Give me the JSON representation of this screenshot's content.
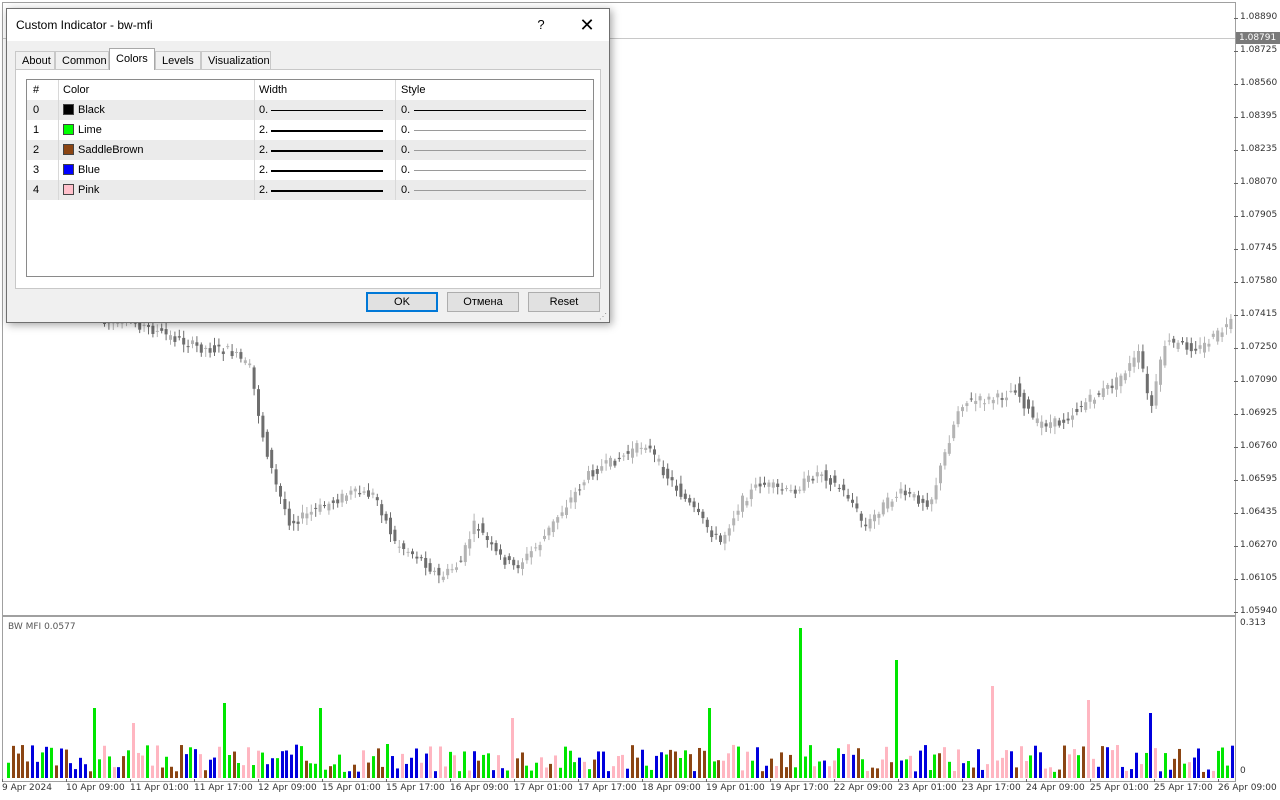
{
  "dialog": {
    "title": "Custom Indicator - bw-mfi",
    "help_label": "?",
    "close_label": "✕",
    "tabs": [
      {
        "label": "About",
        "active": false
      },
      {
        "label": "Common",
        "active": false
      },
      {
        "label": "Colors",
        "active": true
      },
      {
        "label": "Levels",
        "active": false
      },
      {
        "label": "Visualization",
        "active": false
      }
    ],
    "table": {
      "headers": {
        "num": "#",
        "color": "Color",
        "width": "Width",
        "style": "Style"
      },
      "rows": [
        {
          "num": "0",
          "color_name": "Black",
          "swatch": "#000000",
          "width_label": "0.",
          "style_label": "0."
        },
        {
          "num": "1",
          "color_name": "Lime",
          "swatch": "#00ff00",
          "width_label": "2.",
          "style_label": "0."
        },
        {
          "num": "2",
          "color_name": "SaddleBrown",
          "swatch": "#8b4513",
          "width_label": "2.",
          "style_label": "0."
        },
        {
          "num": "3",
          "color_name": "Blue",
          "swatch": "#0000ff",
          "width_label": "2.",
          "style_label": "0."
        },
        {
          "num": "4",
          "color_name": "Pink",
          "swatch": "#ffc0cb",
          "width_label": "2.",
          "style_label": "0."
        }
      ]
    },
    "buttons": {
      "ok": "OK",
      "cancel": "Отмена",
      "reset": "Reset"
    }
  },
  "chart": {
    "current_price": "1.08791",
    "price_ticks": [
      "1.08890",
      "1.08725",
      "1.08560",
      "1.08395",
      "1.08235",
      "1.08070",
      "1.07905",
      "1.07745",
      "1.07580",
      "1.07415",
      "1.07250",
      "1.07090",
      "1.06925",
      "1.06760",
      "1.06595",
      "1.06435",
      "1.06270",
      "1.06105",
      "1.05940"
    ],
    "indicator_label": "BW MFI 0.0577",
    "indicator_ticks": [
      "0.313",
      "0"
    ],
    "time_ticks": [
      "9 Apr 2024",
      "10 Apr 09:00",
      "11 Apr 01:00",
      "11 Apr 17:00",
      "12 Apr 09:00",
      "15 Apr 01:00",
      "15 Apr 17:00",
      "16 Apr 09:00",
      "17 Apr 01:00",
      "17 Apr 17:00",
      "18 Apr 09:00",
      "19 Apr 01:00",
      "19 Apr 17:00",
      "22 Apr 09:00",
      "23 Apr 01:00",
      "23 Apr 17:00",
      "24 Apr 09:00",
      "25 Apr 01:00",
      "25 Apr 17:00",
      "26 Apr 09:00"
    ],
    "colors": {
      "up_candle": "#b4b4b4",
      "down_candle": "#6e6e6e",
      "lime": "#00e600",
      "saddle_brown": "#8b4513",
      "blue": "#0000dd",
      "pink": "#ffb6c1"
    }
  }
}
